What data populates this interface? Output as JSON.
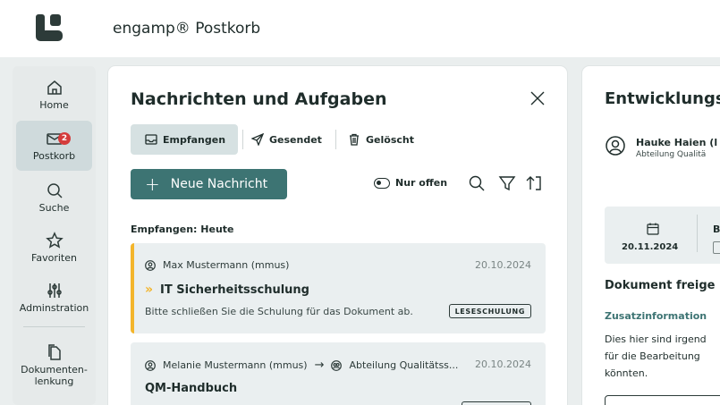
{
  "app": {
    "title": "engamp® Postkorb"
  },
  "nav": {
    "items": [
      {
        "label": "Home",
        "icon": "home-icon"
      },
      {
        "label": "Postkorb",
        "icon": "mail-icon",
        "badge": "2",
        "active": true
      },
      {
        "label": "Suche",
        "icon": "search-icon"
      },
      {
        "label": "Favoriten",
        "icon": "star-icon"
      },
      {
        "label": "Adminstration",
        "icon": "sliders-icon"
      },
      {
        "label": "Dokumenten-\nlenkung",
        "icon": "documents-icon"
      }
    ]
  },
  "messages_panel": {
    "title": "Nachrichten und Aufgaben",
    "tabs": [
      {
        "label": "Empfangen",
        "icon": "inbox-icon",
        "active": true
      },
      {
        "label": "Gesendet",
        "icon": "send-icon"
      },
      {
        "label": "Gelöscht",
        "icon": "trash-icon"
      }
    ],
    "new_button": "Neue Nachricht",
    "filter_toggle": "Nur offen",
    "section_label": "Empfangen: Heute",
    "cards": [
      {
        "sender": "Max Mustermann (mmus)",
        "date": "20.10.2024",
        "subject": "IT Sicherheitsschulung",
        "body": "Bitte schließen Sie die Schulung für das Dokument ab.",
        "tag": "LESESCHULUNG",
        "priority_color": "#f3b52c"
      },
      {
        "sender": "Melanie Mustermann (mmus)",
        "recipient": "Abteilung Qualitätss...",
        "date": "20.10.2024",
        "subject": "QM-Handbuch"
      }
    ]
  },
  "detail_panel": {
    "title": "Entwicklungsr",
    "user_name": "Hauke Haien (l",
    "user_dept": "Abteilung Qualitä",
    "date": "20.11.2024",
    "b_label": "B",
    "section_title": "Dokument freige",
    "subsection": "Zusatzinformation",
    "text_lines": [
      "Dies hier sind irgend",
      "für die Bearbeitung",
      "könnten."
    ]
  },
  "colors": {
    "accent": "#3d7473",
    "badge": "#d43b3b",
    "active_nav": "#cfdadc"
  }
}
